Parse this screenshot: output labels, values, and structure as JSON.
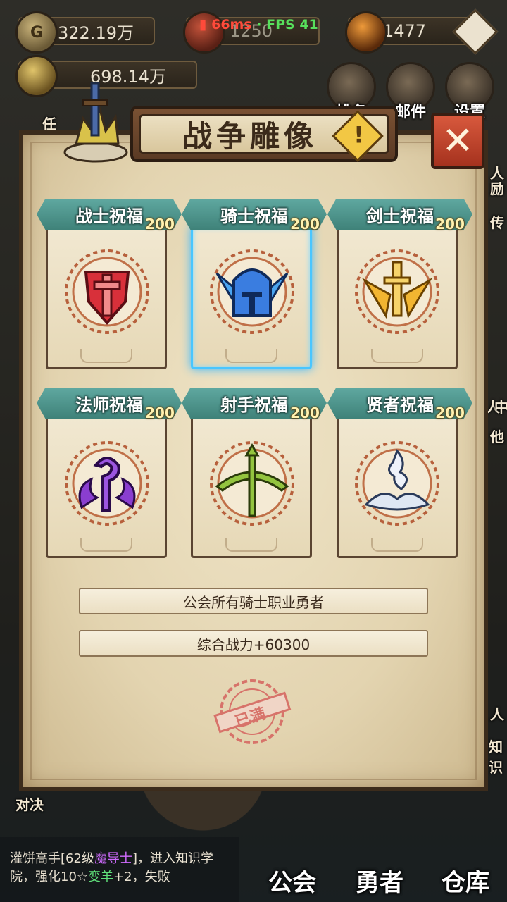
{
  "hud": {
    "coins": "322.19万",
    "resource2": "1250",
    "crystals": "1477",
    "power": "698.14万",
    "ping": "66ms",
    "separator": "·",
    "fps": "FPS 41",
    "coin_glyph": "G"
  },
  "top_buttons": [
    "排名",
    "邮件",
    "设置"
  ],
  "side_labels": {
    "left_task": "任",
    "left_duel": "对决",
    "right_1": "人",
    "right_2": "励",
    "right_3": "传",
    "right_4": "人",
    "right_5": "中",
    "right_6": "他",
    "right_7": "人",
    "right_8": "知识"
  },
  "dialog": {
    "title": "战争雕像",
    "warning_glyph": "!",
    "close_glyph": "✕",
    "cards": [
      {
        "label": "战士祝福",
        "level": "200",
        "icon": "warrior-shield-icon",
        "color": "#d8303a"
      },
      {
        "label": "骑士祝福",
        "level": "200",
        "icon": "knight-helmet-icon",
        "color": "#3a7de0"
      },
      {
        "label": "剑士祝福",
        "level": "200",
        "icon": "winged-sword-icon",
        "color": "#f2b531"
      },
      {
        "label": "法师祝福",
        "level": "200",
        "icon": "mage-flame-icon",
        "color": "#8a3ed0"
      },
      {
        "label": "射手祝福",
        "level": "200",
        "icon": "crossbow-icon",
        "color": "#93c43f"
      },
      {
        "label": "贤者祝福",
        "level": "200",
        "icon": "sage-spirit-icon",
        "color": "#dfe7f3"
      }
    ],
    "selected_index": 1,
    "info_target": "公会所有骑士职业勇者",
    "info_bonus": "综合战力+60300",
    "stamp_text": "已满"
  },
  "chat": {
    "line1_prefix": "灌饼高手[62级",
    "line1_class": "魔导士",
    "line1_suffix": "]，进入知识学",
    "line2_prefix": "院，强化10☆",
    "line2_item": "变羊",
    "line2_suffix": "+2，失败"
  },
  "nav": [
    "公会",
    "勇者",
    "仓库"
  ]
}
